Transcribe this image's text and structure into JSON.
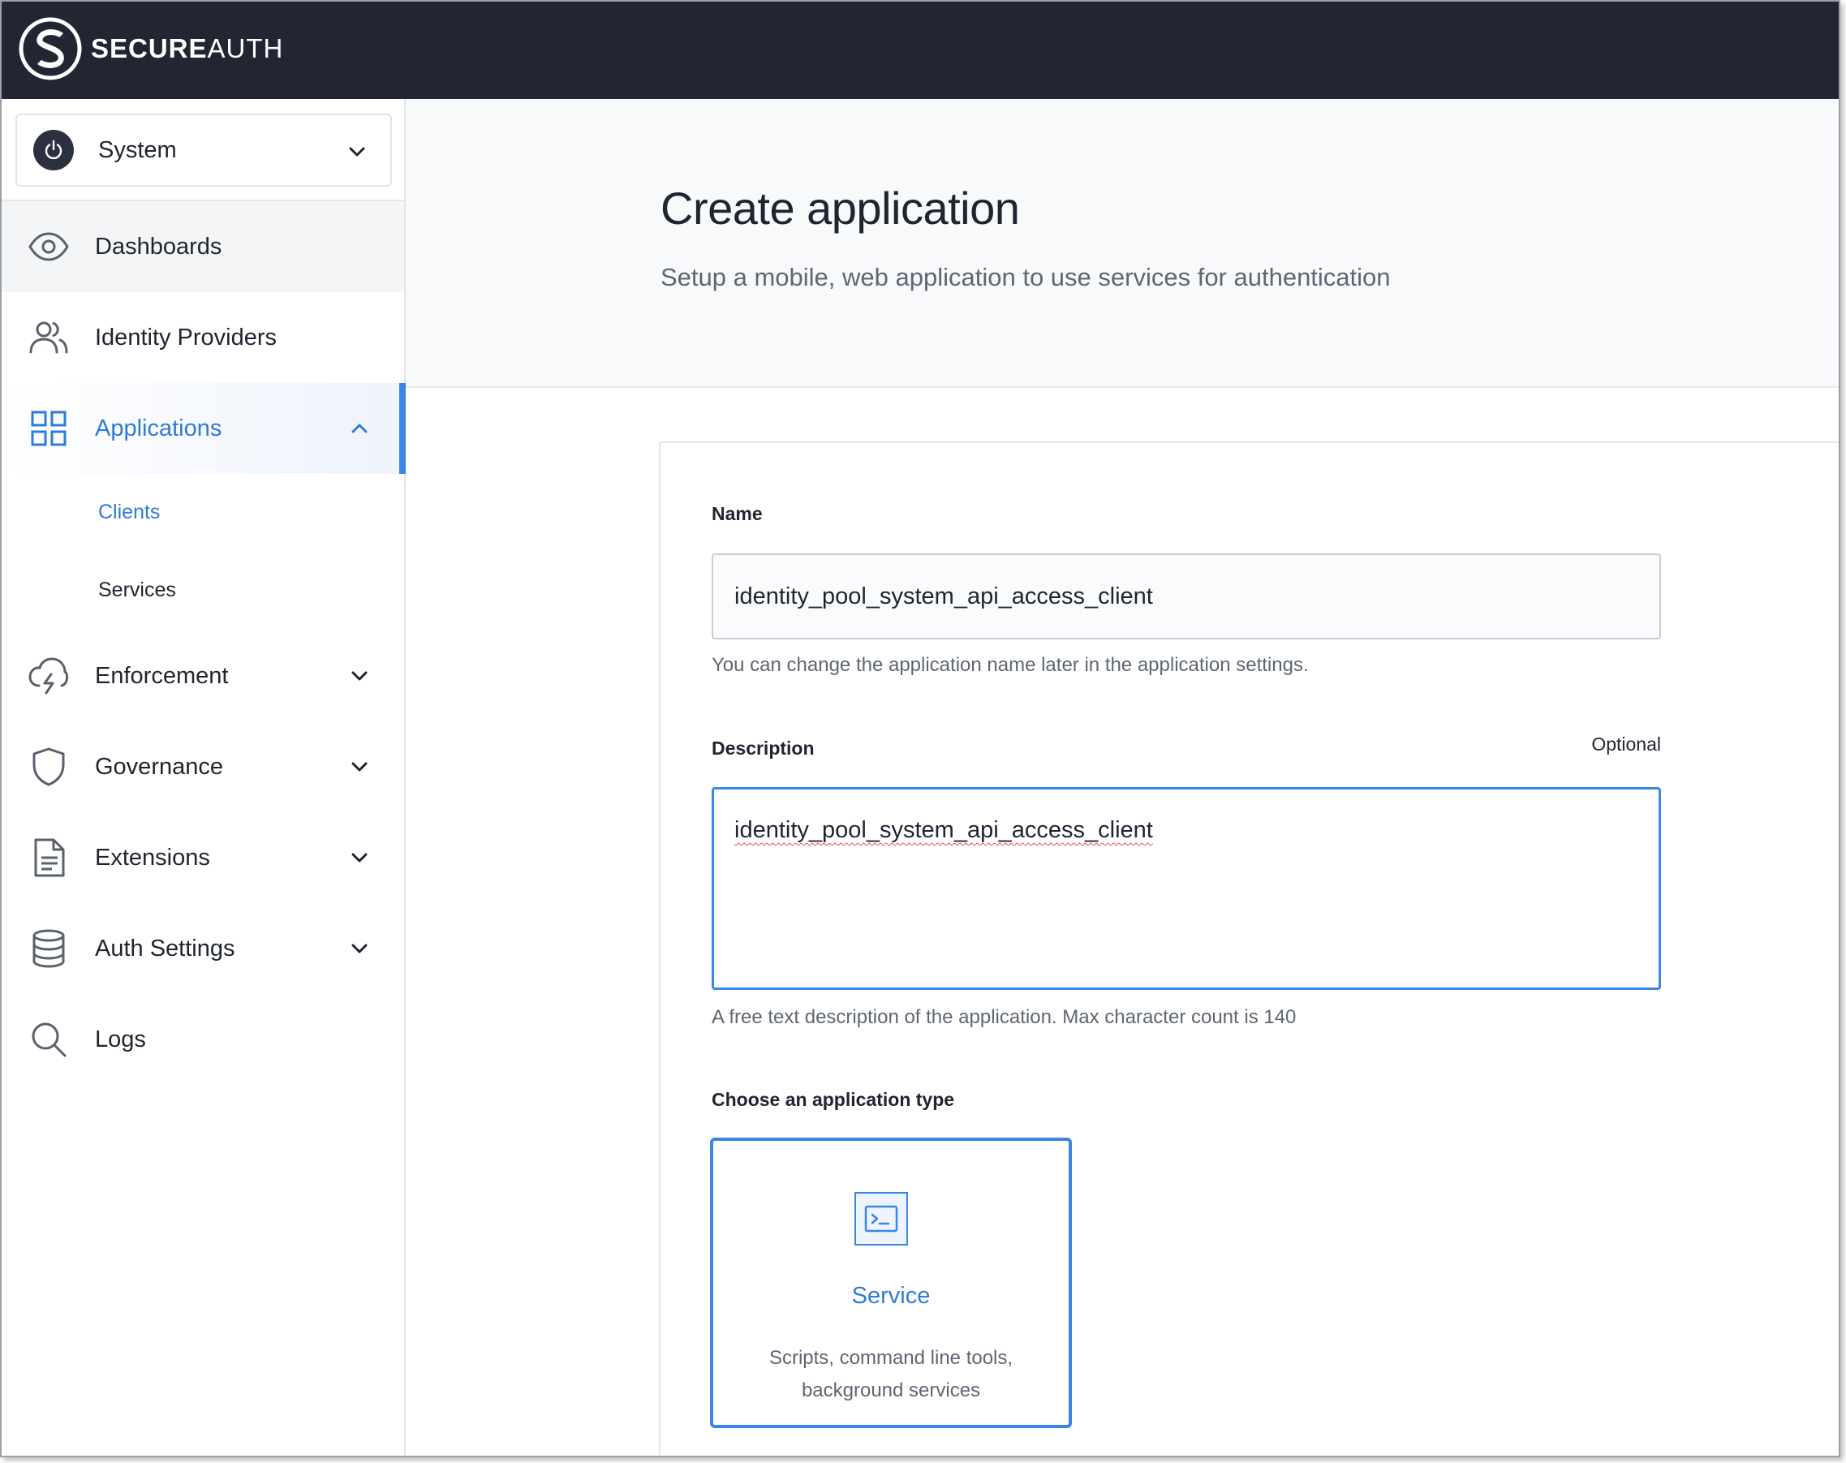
{
  "brand": {
    "bold": "SECURE",
    "light": "AUTH"
  },
  "sidebar": {
    "org_selector": {
      "label": "System",
      "icon": "power-icon"
    },
    "items": [
      {
        "label": "Dashboards",
        "icon": "eye-icon"
      },
      {
        "label": "Identity Providers",
        "icon": "users-icon"
      },
      {
        "label": "Applications",
        "icon": "grid-icon",
        "active": true,
        "children": [
          {
            "label": "Clients",
            "active": true
          },
          {
            "label": "Services"
          }
        ]
      },
      {
        "label": "Enforcement",
        "icon": "cloud-lightning-icon"
      },
      {
        "label": "Governance",
        "icon": "shield-icon"
      },
      {
        "label": "Extensions",
        "icon": "document-icon"
      },
      {
        "label": "Auth Settings",
        "icon": "database-icon"
      },
      {
        "label": "Logs",
        "icon": "search-icon"
      }
    ]
  },
  "main": {
    "title": "Create application",
    "subtitle": "Setup a mobile, web application to use services for authentication",
    "form": {
      "name_label": "Name",
      "name_value": "identity_pool_system_api_access_client",
      "name_help": "You can change the application name later in the application settings.",
      "description_label": "Description",
      "description_optional": "Optional",
      "description_value": "identity_pool_system_api_access_client",
      "description_help": "A free text description of the application. Max character count is 140",
      "type_label": "Choose an application type",
      "type_option": {
        "title": "Service",
        "description": "Scripts, command line tools, background services",
        "icon": "terminal-icon"
      }
    }
  },
  "colors": {
    "topbar": "#222633",
    "accent": "#3a85e6",
    "active_text": "#2f7bd8"
  }
}
